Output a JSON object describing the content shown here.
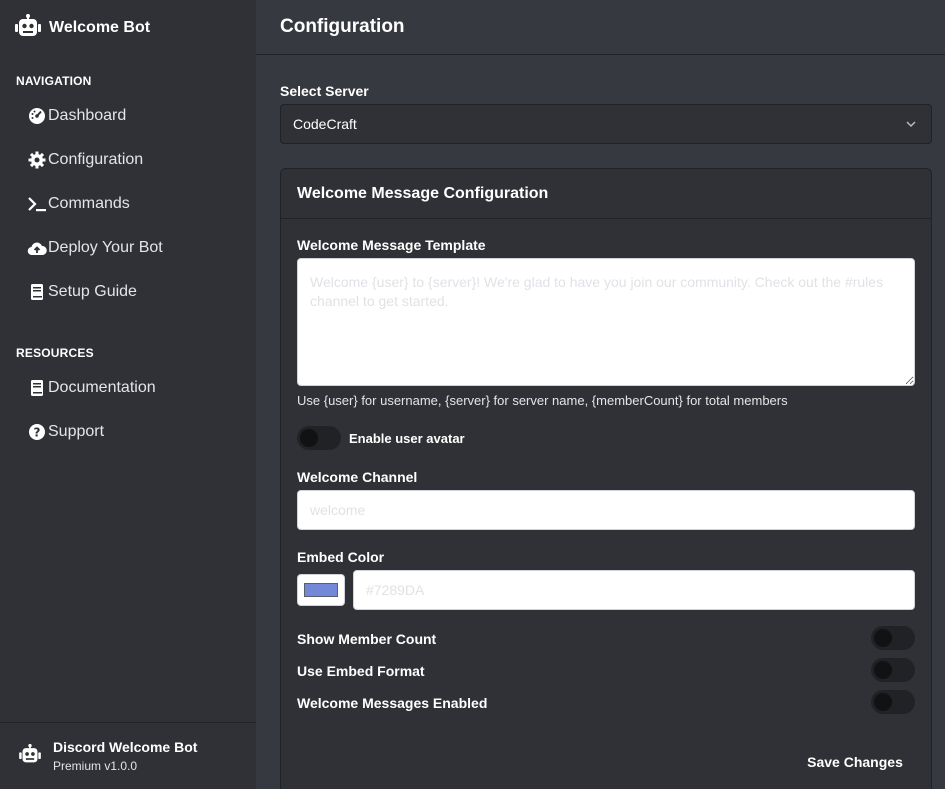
{
  "brand": {
    "name": "Welcome Bot",
    "icon": "robot-icon"
  },
  "navigation": {
    "title": "NAVIGATION",
    "items": [
      {
        "label": "Dashboard",
        "icon": "gauge-icon"
      },
      {
        "label": "Configuration",
        "icon": "gear-icon"
      },
      {
        "label": "Commands",
        "icon": "terminal-icon"
      },
      {
        "label": "Deploy Your Bot",
        "icon": "cloud-upload-icon"
      },
      {
        "label": "Setup Guide",
        "icon": "book-icon"
      }
    ]
  },
  "resources": {
    "title": "RESOURCES",
    "items": [
      {
        "label": "Documentation",
        "icon": "book-icon"
      },
      {
        "label": "Support",
        "icon": "question-circle-icon"
      }
    ]
  },
  "footer": {
    "name": "Discord Welcome Bot",
    "version": "Premium v1.0.0"
  },
  "header": {
    "title": "Configuration"
  },
  "server_select": {
    "label": "Select Server",
    "value": "CodeCraft"
  },
  "card": {
    "title": "Welcome Message Configuration",
    "template_label": "Welcome Message Template",
    "template_placeholder": "Welcome {user} to {server}! We're glad to have you join our community. Check out the #rules channel to get started.",
    "hint": "Use {user} for username, {server} for server name, {memberCount} for total members",
    "avatar_toggle_label": "Enable user avatar",
    "channel_label": "Welcome Channel",
    "channel_placeholder": "welcome",
    "embed_color_label": "Embed Color",
    "embed_color_placeholder": "#7289DA",
    "embed_color_swatch": "#7289da",
    "show_member_count_label": "Show Member Count",
    "use_embed_label": "Use Embed Format",
    "enabled_label": "Welcome Messages Enabled",
    "save_label": "Save Changes"
  },
  "colors": {
    "background": "#36393f",
    "sidebar": "#2f3136",
    "border": "#202225",
    "accent": "#7289da"
  }
}
